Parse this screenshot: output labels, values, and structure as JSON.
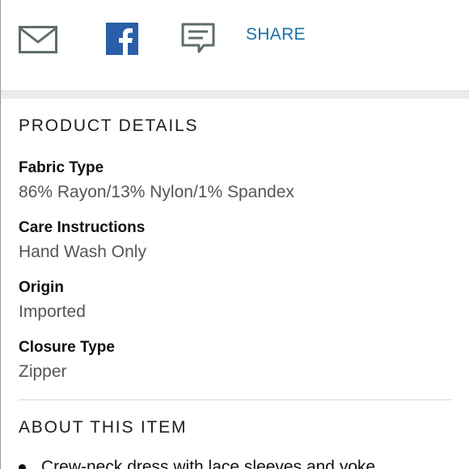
{
  "share": {
    "share_label": "SHARE",
    "icons": [
      "mail-icon",
      "facebook-icon",
      "comment-icon"
    ],
    "colors": {
      "icon_gray": "#5f6b6b",
      "facebook_blue": "#2a5ea6",
      "link_blue": "#1a6fa6"
    }
  },
  "product_details": {
    "title": "PRODUCT DETAILS",
    "items": [
      {
        "label": "Fabric Type",
        "value": "86% Rayon/13% Nylon/1% Spandex"
      },
      {
        "label": "Care Instructions",
        "value": "Hand Wash Only"
      },
      {
        "label": "Origin",
        "value": "Imported"
      },
      {
        "label": "Closure Type",
        "value": "Zipper"
      }
    ]
  },
  "about": {
    "title": "ABOUT THIS ITEM",
    "bullets": [
      "Crew-neck dress with lace sleeves and yoke"
    ]
  }
}
